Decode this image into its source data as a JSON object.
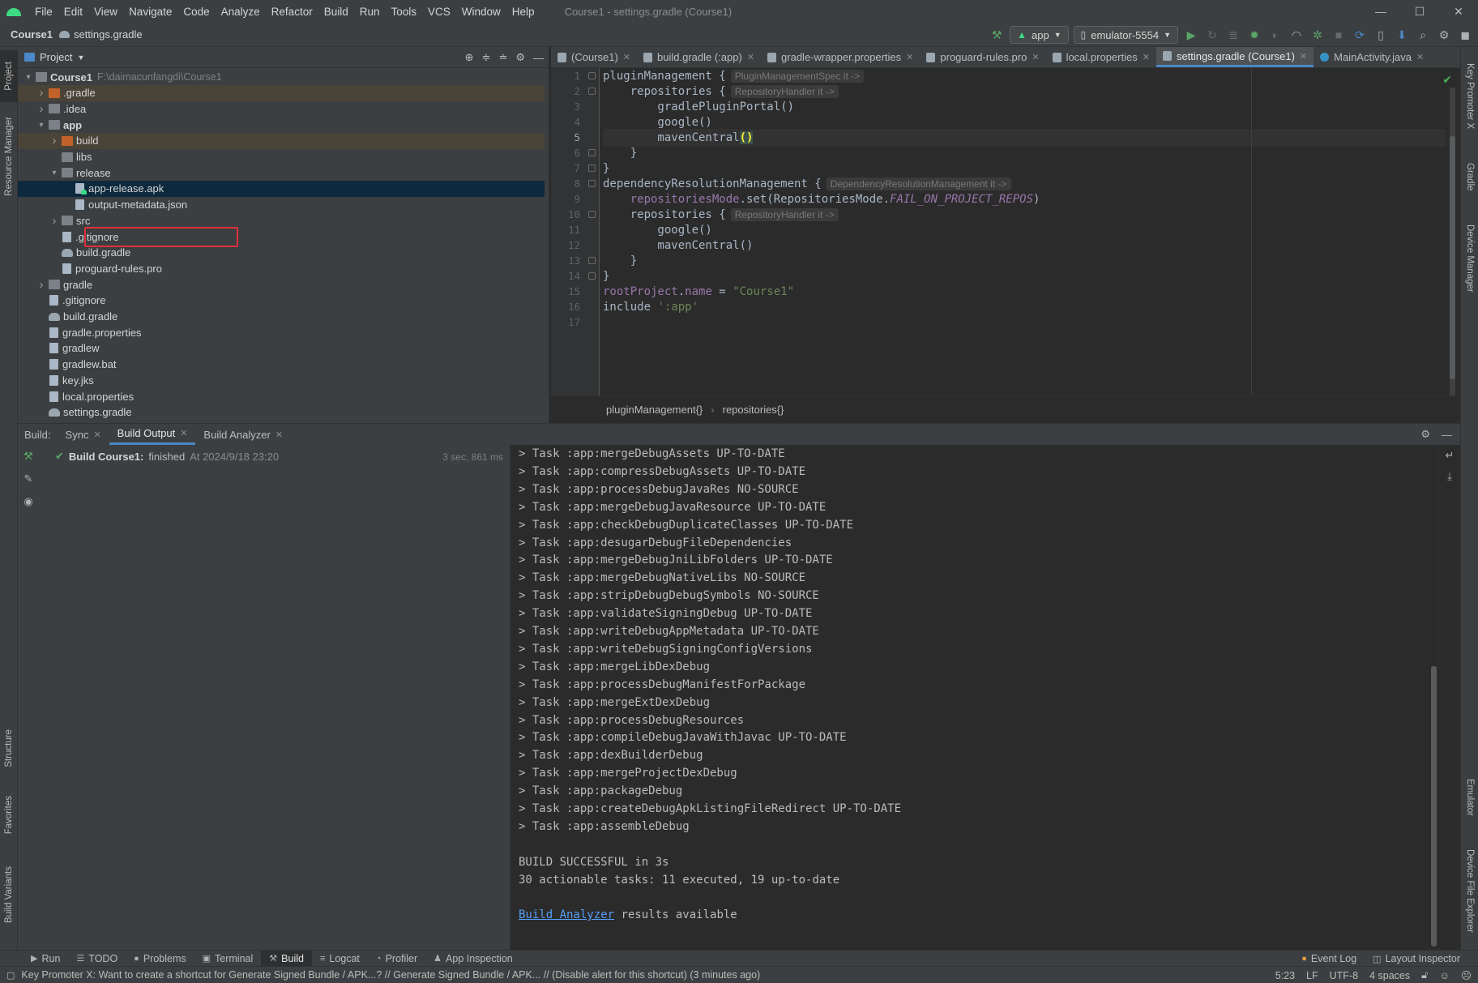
{
  "app": {
    "window_title": "Course1 - settings.gradle (Course1)",
    "menu": [
      "File",
      "Edit",
      "View",
      "Navigate",
      "Code",
      "Analyze",
      "Refactor",
      "Build",
      "Run",
      "Tools",
      "VCS",
      "Window",
      "Help"
    ],
    "window_buttons": [
      "—",
      "☐",
      "✕"
    ]
  },
  "navbar": {
    "project": "Course1",
    "file": "settings.gradle",
    "run_config": "app",
    "device": "emulator-5554"
  },
  "left_strip": [
    "Project",
    "Resource Manager",
    "Structure",
    "Favorites",
    "Build Variants"
  ],
  "right_strip": [
    "Key Promoter X",
    "Gradle",
    "Device Manager",
    "Emulator",
    "Device File Explorer"
  ],
  "project_panel": {
    "title": "Project",
    "tree": [
      {
        "label": "Course1",
        "path": "F:\\daimacunfangdi\\Course1",
        "depth": 0,
        "arrow": "open",
        "icon": "folder",
        "bold": true
      },
      {
        "label": ".gradle",
        "depth": 1,
        "arrow": "closed",
        "icon": "folder-orange",
        "excluded": true
      },
      {
        "label": ".idea",
        "depth": 1,
        "arrow": "closed",
        "icon": "folder"
      },
      {
        "label": "app",
        "depth": 1,
        "arrow": "open",
        "icon": "folder",
        "bold": true
      },
      {
        "label": "build",
        "depth": 2,
        "arrow": "closed",
        "icon": "folder-orange",
        "excluded": true
      },
      {
        "label": "libs",
        "depth": 2,
        "arrow": "none",
        "icon": "folder"
      },
      {
        "label": "release",
        "depth": 2,
        "arrow": "open",
        "icon": "folder"
      },
      {
        "label": "app-release.apk",
        "depth": 3,
        "arrow": "none",
        "icon": "apk",
        "selected": true
      },
      {
        "label": "output-metadata.json",
        "depth": 3,
        "arrow": "none",
        "icon": "file"
      },
      {
        "label": "src",
        "depth": 2,
        "arrow": "closed",
        "icon": "folder"
      },
      {
        "label": ".gitignore",
        "depth": 2,
        "arrow": "none",
        "icon": "file"
      },
      {
        "label": "build.gradle",
        "depth": 2,
        "arrow": "none",
        "icon": "gradle"
      },
      {
        "label": "proguard-rules.pro",
        "depth": 2,
        "arrow": "none",
        "icon": "file"
      },
      {
        "label": "gradle",
        "depth": 1,
        "arrow": "closed",
        "icon": "folder"
      },
      {
        "label": ".gitignore",
        "depth": 1,
        "arrow": "none",
        "icon": "file"
      },
      {
        "label": "build.gradle",
        "depth": 1,
        "arrow": "none",
        "icon": "gradle"
      },
      {
        "label": "gradle.properties",
        "depth": 1,
        "arrow": "none",
        "icon": "file"
      },
      {
        "label": "gradlew",
        "depth": 1,
        "arrow": "none",
        "icon": "file"
      },
      {
        "label": "gradlew.bat",
        "depth": 1,
        "arrow": "none",
        "icon": "file"
      },
      {
        "label": "key.jks",
        "depth": 1,
        "arrow": "none",
        "icon": "file"
      },
      {
        "label": "local.properties",
        "depth": 1,
        "arrow": "none",
        "icon": "file"
      },
      {
        "label": "settings.gradle",
        "depth": 1,
        "arrow": "none",
        "icon": "gradle"
      }
    ]
  },
  "editor": {
    "tabs": [
      {
        "label": "(Course1)",
        "icon": "gradle"
      },
      {
        "label": "build.gradle (:app)",
        "icon": "gradle"
      },
      {
        "label": "gradle-wrapper.properties",
        "icon": "file"
      },
      {
        "label": "proguard-rules.pro",
        "icon": "file"
      },
      {
        "label": "local.properties",
        "icon": "file"
      },
      {
        "label": "settings.gradle (Course1)",
        "icon": "gradle",
        "active": true
      },
      {
        "label": "MainActivity.java",
        "icon": "java"
      }
    ],
    "current_line": 5,
    "lines": [
      {
        "n": 1,
        "fold": true,
        "parts": [
          [
            "t",
            "pluginManagement {"
          ]
        ],
        "hint": "PluginManagementSpec it ->"
      },
      {
        "n": 2,
        "fold": true,
        "parts": [
          [
            "t",
            "    repositories {"
          ]
        ],
        "hint": "RepositoryHandler it ->"
      },
      {
        "n": 3,
        "parts": [
          [
            "t",
            "        gradlePluginPortal()"
          ]
        ]
      },
      {
        "n": 4,
        "parts": [
          [
            "t",
            "        google()"
          ]
        ]
      },
      {
        "n": 5,
        "parts": [
          [
            "t",
            "        mavenCentral"
          ],
          [
            "hl",
            "()"
          ]
        ]
      },
      {
        "n": 6,
        "fold": true,
        "parts": [
          [
            "t",
            "    }"
          ]
        ]
      },
      {
        "n": 7,
        "fold": true,
        "parts": [
          [
            "t",
            "}"
          ]
        ]
      },
      {
        "n": 8,
        "fold": true,
        "parts": [
          [
            "t",
            "dependencyResolutionManagement {"
          ]
        ],
        "hint": "DependencyResolutionManagement it ->"
      },
      {
        "n": 9,
        "parts": [
          [
            "t",
            "    "
          ],
          [
            "p",
            "repositoriesMode"
          ],
          [
            "t",
            ".set(RepositoriesMode."
          ],
          [
            "e",
            "FAIL_ON_PROJECT_REPOS"
          ],
          [
            "t",
            ")"
          ]
        ]
      },
      {
        "n": 10,
        "fold": true,
        "parts": [
          [
            "t",
            "    repositories {"
          ]
        ],
        "hint": "RepositoryHandler it ->"
      },
      {
        "n": 11,
        "parts": [
          [
            "t",
            "        google()"
          ]
        ]
      },
      {
        "n": 12,
        "parts": [
          [
            "t",
            "        mavenCentral()"
          ]
        ]
      },
      {
        "n": 13,
        "fold": true,
        "parts": [
          [
            "t",
            "    }"
          ]
        ]
      },
      {
        "n": 14,
        "fold": true,
        "parts": [
          [
            "t",
            "}"
          ]
        ]
      },
      {
        "n": 15,
        "parts": [
          [
            "p",
            "rootProject"
          ],
          [
            "t",
            "."
          ],
          [
            "p",
            "name"
          ],
          [
            "t",
            " = "
          ],
          [
            "s",
            "\"Course1\""
          ]
        ]
      },
      {
        "n": 16,
        "parts": [
          [
            "t",
            "include "
          ],
          [
            "s",
            "':app'"
          ]
        ]
      },
      {
        "n": 17,
        "parts": [
          [
            "t",
            ""
          ]
        ]
      }
    ],
    "breadcrumbs": [
      "pluginManagement{}",
      "repositories{}"
    ]
  },
  "build_panel": {
    "label": "Build:",
    "tabs": [
      {
        "label": "Sync"
      },
      {
        "label": "Build Output",
        "active": true
      },
      {
        "label": "Build Analyzer"
      }
    ],
    "status_bold": "Build Course1:",
    "status_text": "finished",
    "status_when": "At 2024/9/18 23:20",
    "duration": "3 sec, 861 ms",
    "output_lines": [
      "> Task :app:mergeDebugAssets UP-TO-DATE",
      "> Task :app:compressDebugAssets UP-TO-DATE",
      "> Task :app:processDebugJavaRes NO-SOURCE",
      "> Task :app:mergeDebugJavaResource UP-TO-DATE",
      "> Task :app:checkDebugDuplicateClasses UP-TO-DATE",
      "> Task :app:desugarDebugFileDependencies",
      "> Task :app:mergeDebugJniLibFolders UP-TO-DATE",
      "> Task :app:mergeDebugNativeLibs NO-SOURCE",
      "> Task :app:stripDebugDebugSymbols NO-SOURCE",
      "> Task :app:validateSigningDebug UP-TO-DATE",
      "> Task :app:writeDebugAppMetadata UP-TO-DATE",
      "> Task :app:writeDebugSigningConfigVersions",
      "> Task :app:mergeLibDexDebug",
      "> Task :app:processDebugManifestForPackage",
      "> Task :app:mergeExtDexDebug",
      "> Task :app:processDebugResources",
      "> Task :app:compileDebugJavaWithJavac UP-TO-DATE",
      "> Task :app:dexBuilderDebug",
      "> Task :app:mergeProjectDexDebug",
      "> Task :app:packageDebug",
      "> Task :app:createDebugApkListingFileRedirect UP-TO-DATE",
      "> Task :app:assembleDebug",
      "",
      "BUILD SUCCESSFUL in 3s",
      "30 actionable tasks: 11 executed, 19 up-to-date",
      ""
    ],
    "analyzer_link": "Build Analyzer",
    "analyzer_suffix": " results available"
  },
  "bottom_tools": [
    {
      "label": "Run",
      "icon": "▶"
    },
    {
      "label": "TODO",
      "icon": "☰"
    },
    {
      "label": "Problems",
      "icon": "●"
    },
    {
      "label": "Terminal",
      "icon": "▣"
    },
    {
      "label": "Build",
      "icon": "⚒",
      "active": true
    },
    {
      "label": "Logcat",
      "icon": "≡"
    },
    {
      "label": "Profiler",
      "icon": "◔"
    },
    {
      "label": "App Inspection",
      "icon": "♟"
    }
  ],
  "bottom_right": [
    {
      "label": "Event Log",
      "icon": "●"
    },
    {
      "label": "Layout Inspector",
      "icon": "◫"
    }
  ],
  "status_bar": {
    "message": "Key Promoter X: Want to create a shortcut for Generate Signed Bundle / APK...? // Generate Signed Bundle / APK... // (Disable alert for this shortcut) (3 minutes ago)",
    "position": "5:23",
    "line_sep": "LF",
    "encoding": "UTF-8",
    "indent": "4 spaces"
  }
}
